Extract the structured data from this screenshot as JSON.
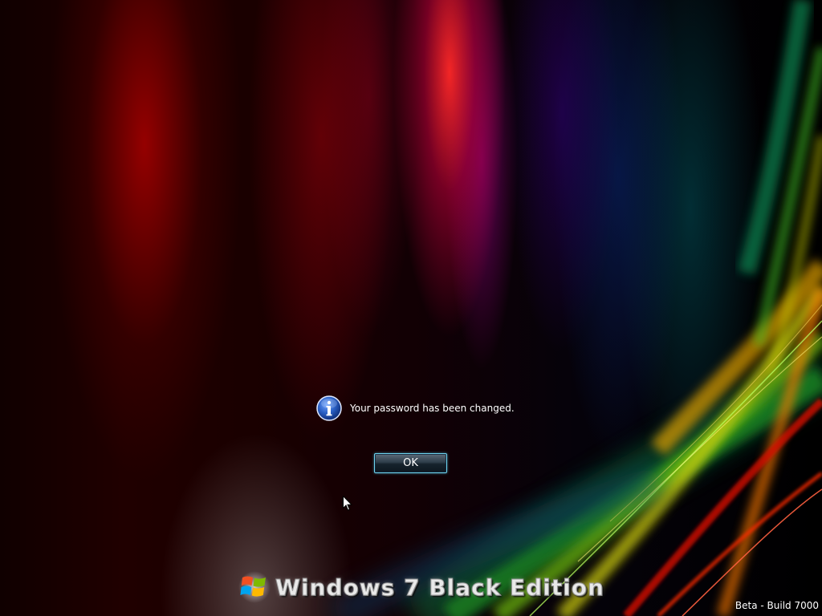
{
  "logon_screen": {
    "message": "Your password has been changed.",
    "ok_label": "OK",
    "branding_text": "Windows 7 Black Edition",
    "build_label": "Beta - Build 7000"
  },
  "icons": {
    "message_icon": "info-icon",
    "branding_icon": "windows-flag-icon",
    "pointer": "mouse-cursor"
  },
  "colors": {
    "background": "#000000",
    "text": "#ffffff",
    "button_border": "#6fd4ee",
    "info_icon_blue": "#2a5fc4"
  }
}
